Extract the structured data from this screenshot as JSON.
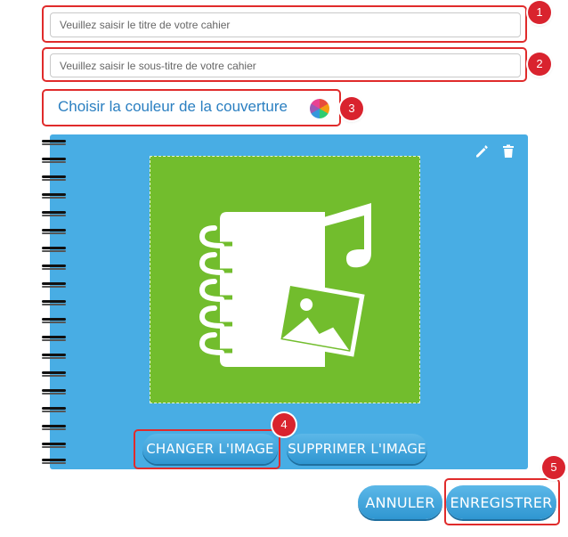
{
  "form": {
    "title_placeholder": "Veuillez saisir le titre de votre cahier",
    "subtitle_placeholder": "Veuillez saisir le sous-titre de votre cahier",
    "color_label": "Choisir la couleur de la couverture"
  },
  "badges": [
    "1",
    "2",
    "3",
    "4",
    "5"
  ],
  "cover": {
    "background_color": "#48ade4",
    "image_background_color": "#72bd2d",
    "edit_icon": "pencil-icon",
    "delete_icon": "trash-icon"
  },
  "buttons": {
    "change_image": "CHANGER L'IMAGE",
    "remove_image": "SUPPRIMER L'IMAGE",
    "cancel": "ANNULER",
    "save": "ENREGISTRER"
  },
  "colors": {
    "highlight": "#e02b2b",
    "badge": "#d9232e",
    "label": "#2a7fc1",
    "button": "#2f96d1"
  }
}
